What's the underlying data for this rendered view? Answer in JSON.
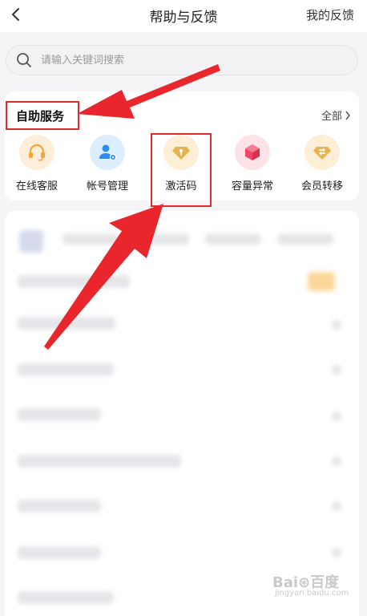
{
  "header": {
    "title": "帮助与反馈",
    "feedback": "我的反馈"
  },
  "search": {
    "placeholder": "请输入关键词搜索"
  },
  "self_service": {
    "title": "自助服务",
    "all_link": "全部",
    "items": [
      {
        "label": "在线客服",
        "icon": "headset-icon",
        "bg": "#fdeed9",
        "color": "#f3a43a"
      },
      {
        "label": "帐号管理",
        "icon": "user-gear-icon",
        "bg": "#dceefc",
        "color": "#2d8cf0"
      },
      {
        "label": "激活码",
        "icon": "diamond-key-icon",
        "bg": "#fcefd6",
        "color": "#e8b14f"
      },
      {
        "label": "容量异常",
        "icon": "cube-icon",
        "bg": "#fde3e8",
        "color": "#f0466a"
      },
      {
        "label": "会员转移",
        "icon": "diamond-transfer-icon",
        "bg": "#fcefd6",
        "color": "#e8b14f"
      }
    ]
  },
  "watermark": {
    "text": "Bai⊛百度",
    "sub": "jingyan.baidu.com"
  },
  "colors": {
    "annotation_red": "#e02b2b"
  }
}
